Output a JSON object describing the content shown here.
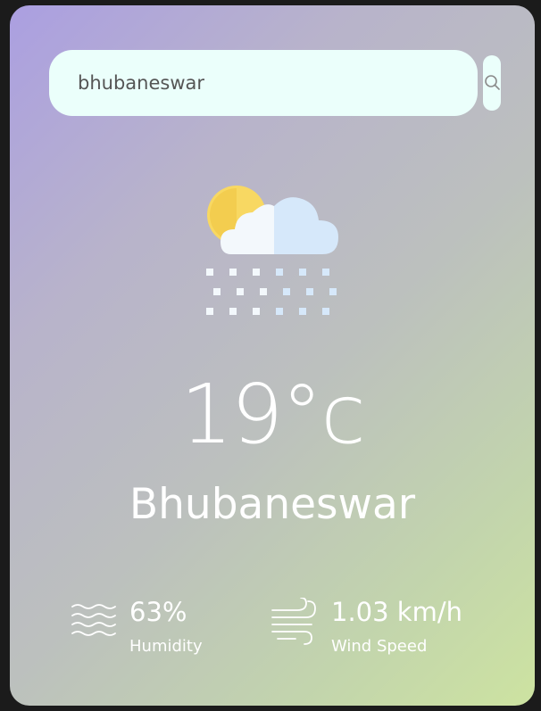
{
  "search": {
    "value": "bhubaneswar",
    "icon": "search-icon"
  },
  "weather": {
    "icon": "cloud-snow-icon",
    "temperature": "19°c",
    "city": "Bhubaneswar"
  },
  "details": {
    "humidity": {
      "value": "63%",
      "label": "Humidity",
      "icon": "humidity-waves-icon"
    },
    "wind": {
      "value": "1.03 km/h",
      "label": "Wind Speed",
      "icon": "wind-icon"
    }
  },
  "colors": {
    "gradient_start": "#ab9fe1",
    "gradient_end": "#cde3a1",
    "search_bg": "#ebfffb",
    "text": "#ffffff"
  }
}
